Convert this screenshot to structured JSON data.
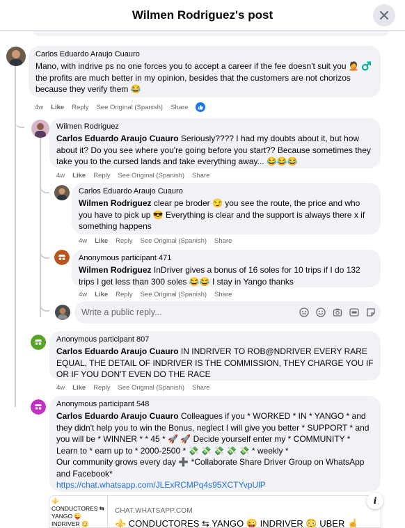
{
  "header": {
    "title": "Wilmen Rodriguez's post"
  },
  "comments": [
    {
      "name": "Carlos Eduardo Araujo Cuauro",
      "text": "Mano, with indrive ps no one forces you to accept a career if the fee doesn't suit you 🤦 ♂️ the profits are much better in my opinion, besides that the customers are not chorizos because they verify them 😂",
      "time": "4w",
      "like": "Like",
      "reply": "Reply",
      "see_original": "See Original (Spanish)",
      "share": "Share"
    },
    {
      "name": "Wilmen Rodriguez",
      "mention": "Carlos Eduardo Araujo Cuauro",
      "text": " Seriously???? I had my doubts about it, but how about it? Do you see where you're going before you start?? Because sometimes they take you to the cursed lands and take everything away... 😂😂😂",
      "time": "4w",
      "like": "Like",
      "reply": "Reply",
      "see_original": "See Original (Spanish)",
      "share": "Share"
    },
    {
      "name": "Carlos Eduardo Araujo Cuauro",
      "mention": "Wilmen Rodriguez",
      "text": " clear pe broder 😏 you see the route, the price and who you have to pick up 😎 Everything is clear and the support is always there x if something happens",
      "time": "4w",
      "like": "Like",
      "reply": "Reply",
      "see_original": "See Original (Spanish)",
      "share": "Share"
    },
    {
      "name": "Anonymous participant 471",
      "mention": "Wilmen Rodriguez",
      "text": " InDriver gives a bonus of 16 soles for 10 trips if I do 132 trips I get less than 300 soles 😂😂 I stay in Yango thanks",
      "time": "4w",
      "like": "Like",
      "reply": "Reply",
      "see_original": "See Original (Spanish)",
      "share": "Share"
    },
    {
      "name": "Anonymous participant 807",
      "mention": "Carlos Eduardo Araujo Cuauro",
      "text": " IN INDRIVER TO ROB@NDRIVER EVERY RARE EQUAL, THE DETAIL OF INDRIVER IS THE COMMISSION, THEY CHARGE YOU IF OR IF YOU DON'T EVEN DO THE RACE",
      "time": "4w",
      "like": "Like",
      "reply": "Reply",
      "see_original": "See Original (Spanish)",
      "share": "Share"
    },
    {
      "name": "Anonymous participant 548",
      "mention": "Carlos Eduardo Araujo Cuauro",
      "text": " Colleagues if you * WORKED * IN * YANGO * and they didn't help you to win the Bonus, neglect I will give you better * SUPPORT * and you will be * WINNER * * 45 * 🚀 🚀 Decide yourself enter my * COMMUNITY * Learn to * earn up to * 2000-2500 * 💸 💸 💸 💸 💸 * weekly *",
      "text2": "Our community grows every day ➕ *Collaborate Share Driver Group on WhatsApp and Facebook*",
      "link": "https://chat.whatsapp.com/JLExRCMPq4s95XCTYvpUlP"
    }
  ],
  "reply_box": {
    "placeholder": "Write a public reply..."
  },
  "link_preview": {
    "thumb_text": "⚜️ CONDUCTORES ⇆ YANGO 😜 INDRIVER 😳 UBER",
    "domain": "CHAT.WHATSAPP.COM",
    "title": "⚜️ CONDUCTORES ⇆ YANGO 😜 INDRIVER 😳 UBER ☝️"
  },
  "colors": {
    "bubble": "#f0f2f5",
    "link": "#216fdb",
    "like_badge": "#1877f2",
    "meta": "#65676b"
  },
  "icons": [
    "close-icon",
    "like-icon",
    "avatar-sticker-icon",
    "emoji-icon",
    "camera-icon",
    "gif-icon",
    "sticker-icon",
    "info-icon"
  ]
}
